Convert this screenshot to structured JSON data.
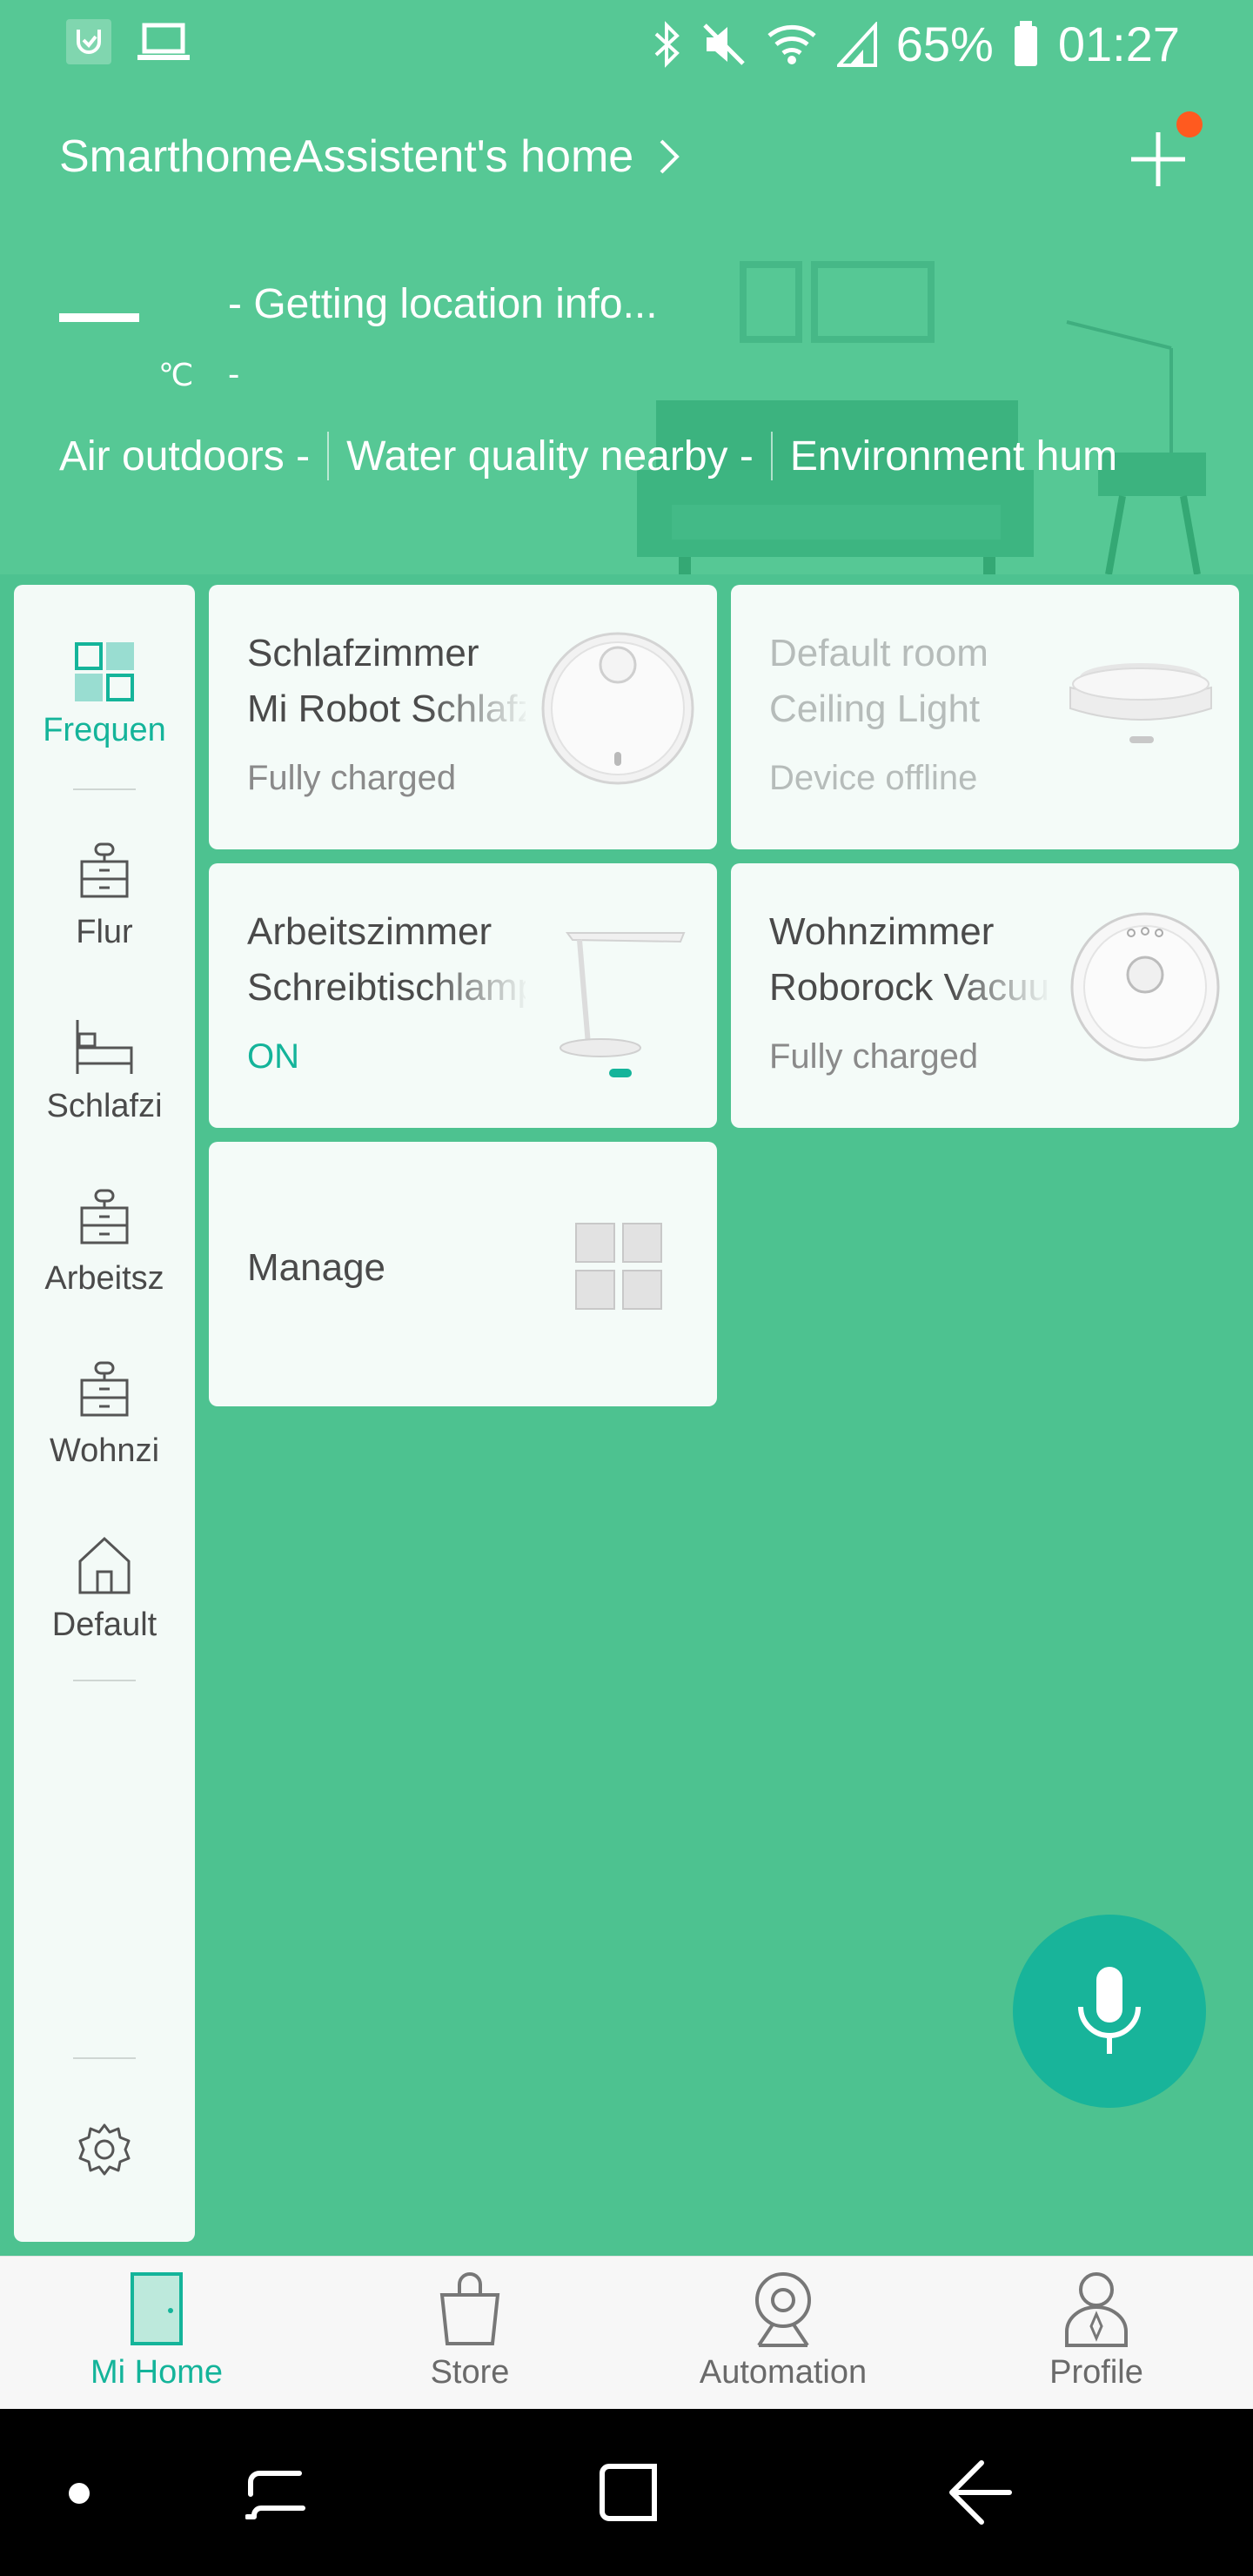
{
  "status_bar": {
    "battery": "65%",
    "time": "01:27",
    "left_icons": [
      "mi-notification-icon",
      "laptop-icon"
    ],
    "right_icons": [
      "bluetooth-icon",
      "mute-icon",
      "wifi-icon",
      "signal-icon",
      "battery-icon"
    ]
  },
  "header": {
    "home_title": "SmarthomeAssistent's home",
    "temperature_unit": "℃",
    "location_text": "- Getting location info...",
    "location_sub": "-",
    "env": {
      "air": "Air outdoors -",
      "water": "Water quality nearby -",
      "humidity": "Environment hum"
    },
    "colors": {
      "background": "#56c895",
      "notification_dot": "#ff5a1f"
    }
  },
  "sidebar": {
    "items": [
      {
        "label": "Frequen",
        "icon": "grid-icon",
        "active": true
      },
      {
        "label": "Flur",
        "icon": "cabinet-icon",
        "active": false
      },
      {
        "label": "Schlafzi",
        "icon": "bed-icon",
        "active": false
      },
      {
        "label": "Arbeitsz",
        "icon": "cabinet-icon",
        "active": false
      },
      {
        "label": "Wohnzi",
        "icon": "cabinet-icon",
        "active": false
      },
      {
        "label": "Default",
        "icon": "house-icon",
        "active": false
      }
    ],
    "settings_icon": "gear-icon"
  },
  "devices": [
    {
      "room": "Schlafzimmer",
      "name": "Mi Robot Schlafzimmer",
      "status": "Fully charged",
      "icon": "robot-vacuum-image",
      "offline": false
    },
    {
      "room": "Default room",
      "name": "Ceiling Light",
      "status": "Device offline",
      "icon": "ceiling-light-image",
      "offline": true
    },
    {
      "room": "Arbeitszimmer",
      "name": "Schreibtischlampe",
      "status": "ON",
      "icon": "desk-lamp-image",
      "offline": false
    },
    {
      "room": "Wohnzimmer",
      "name": "Roborock Vacuum",
      "status": "Fully charged",
      "icon": "roborock-vacuum-image",
      "offline": false
    }
  ],
  "manage": {
    "label": "Manage",
    "icon": "grid-manage-icon"
  },
  "fab": {
    "icon": "microphone-icon",
    "color": "#18b49a"
  },
  "bottom_nav": {
    "tabs": [
      {
        "label": "Mi Home",
        "icon": "door-icon",
        "active": true
      },
      {
        "label": "Store",
        "icon": "bag-icon",
        "active": false
      },
      {
        "label": "Automation",
        "icon": "camera-icon",
        "active": false
      },
      {
        "label": "Profile",
        "icon": "person-icon",
        "active": false
      }
    ],
    "accent": "#14b49a"
  },
  "system_nav": {
    "buttons": [
      "dot-icon",
      "recents-icon",
      "home-square-icon",
      "back-icon"
    ]
  }
}
